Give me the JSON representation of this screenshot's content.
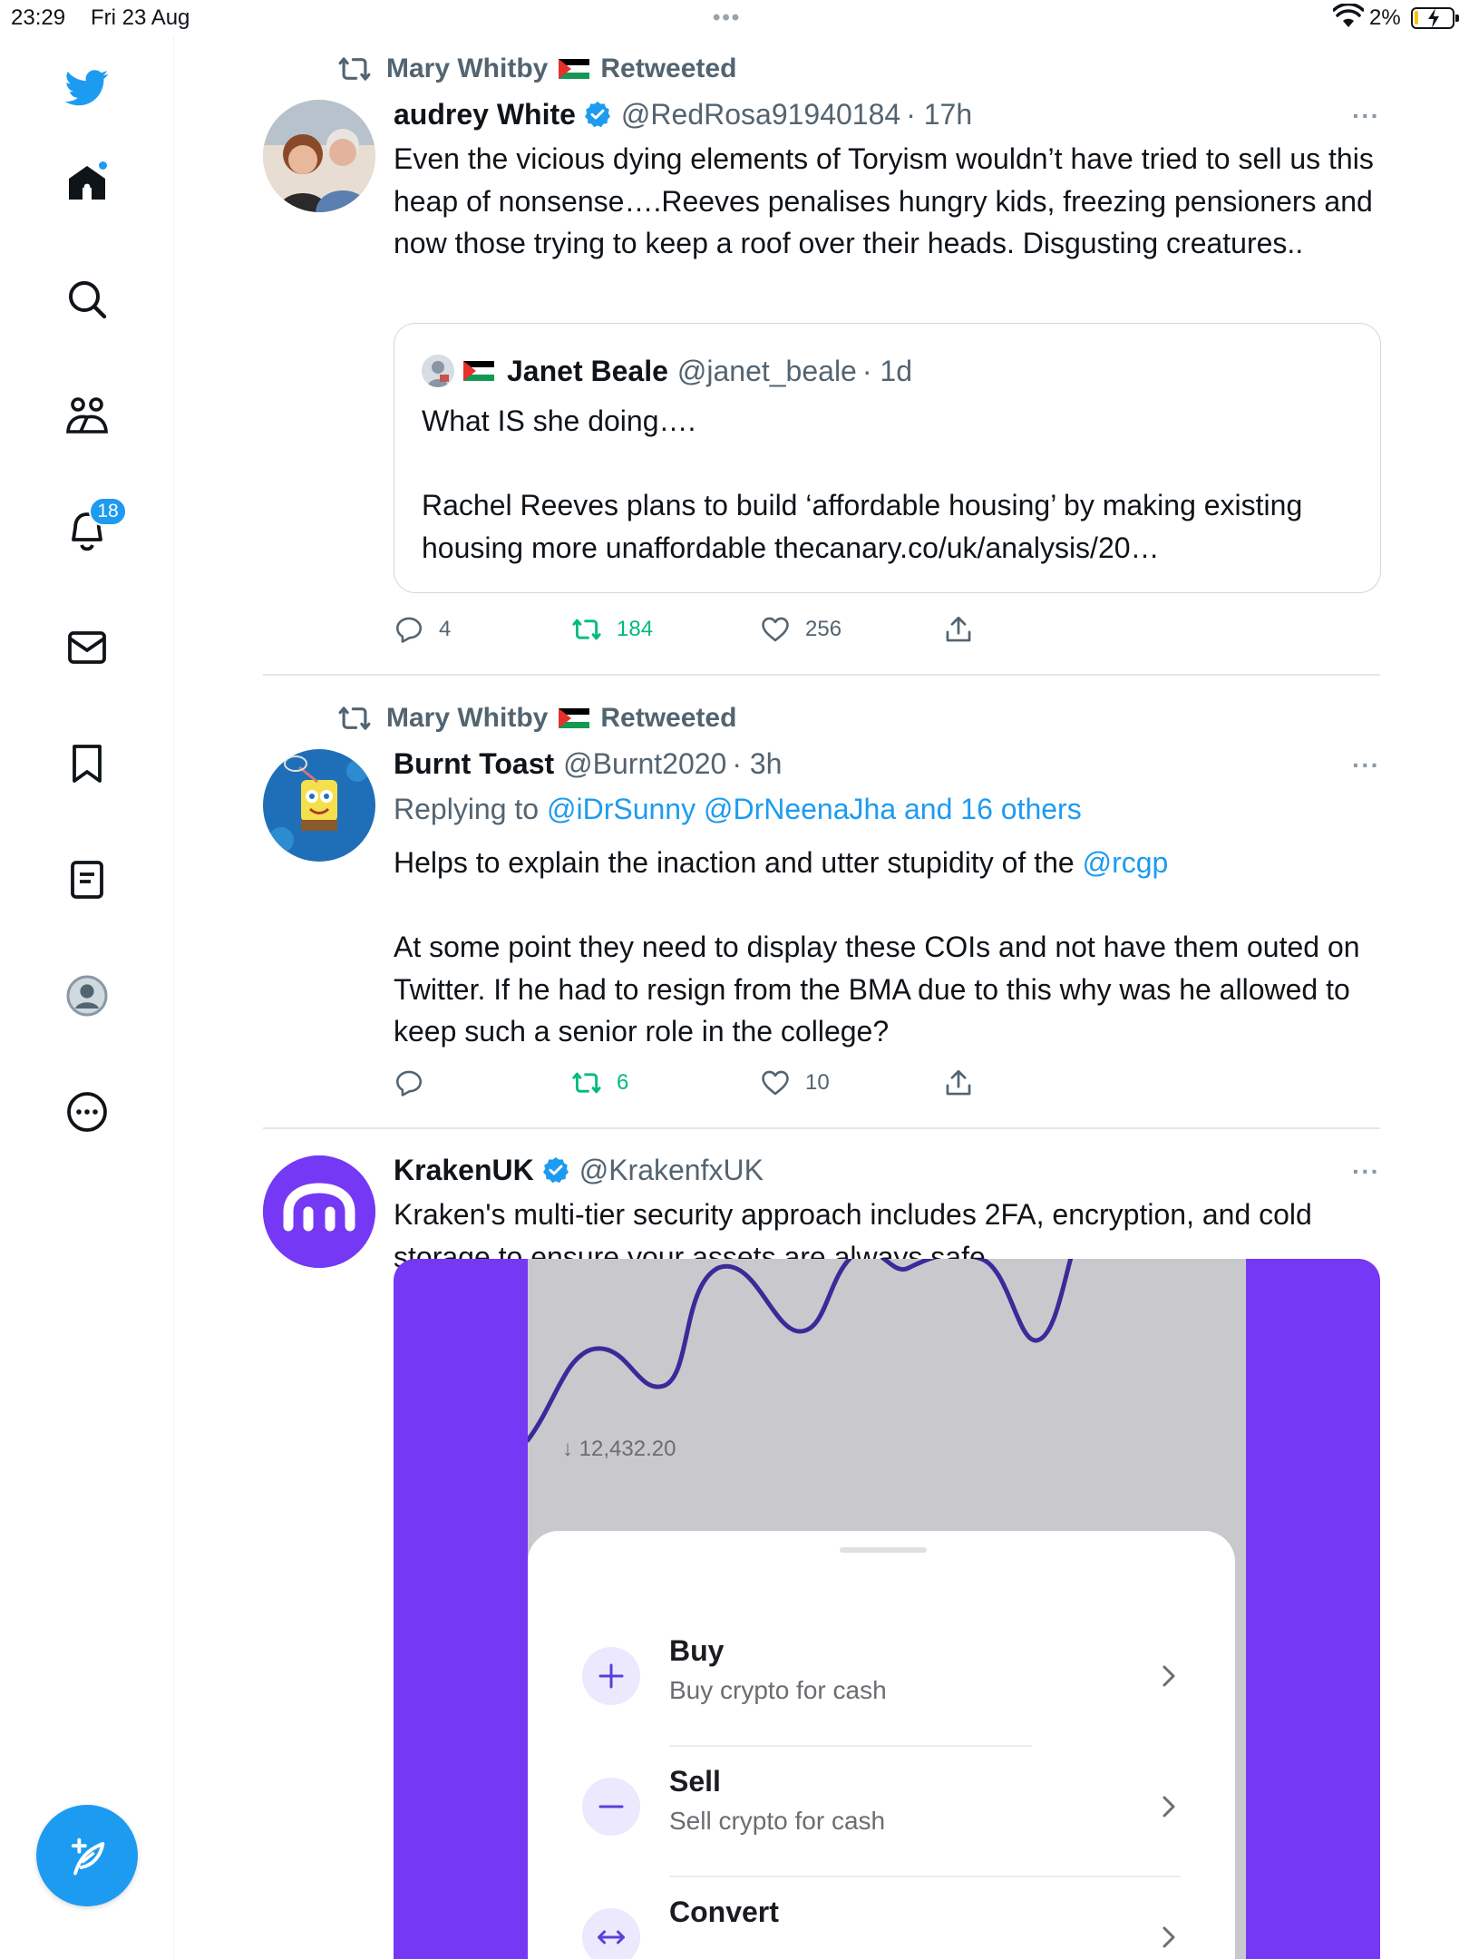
{
  "status_bar": {
    "time": "23:29",
    "date": "Fri 23 Aug",
    "dots": "•••",
    "battery_pct": "2%"
  },
  "sidebar": {
    "notifications_badge": "18"
  },
  "tweets": [
    {
      "retweeted_by": "Mary Whitby",
      "retweeted_label": "Retweeted",
      "name": "audrey White",
      "handle": "@RedRosa91940184",
      "time": "· 17h",
      "more": "···",
      "text": "Even the vicious dying elements of Toryism wouldn’t have tried to sell us this heap of nonsense….Reeves penalises hungry kids, freezing pensioners and now those trying to keep a roof over their heads. Disgusting creatures..",
      "quote": {
        "name": "Janet Beale",
        "handle": "@janet_beale",
        "time": "· 1d",
        "text_line1": "What IS she doing….",
        "text_line2": "Rachel Reeves plans to build ‘affordable housing’ by making existing housing more unaffordable thecanary.co/uk/analysis/20…"
      },
      "replies": "4",
      "retweets": "184",
      "likes": "256"
    },
    {
      "retweeted_by": "Mary Whitby",
      "retweeted_label": "Retweeted",
      "name": "Burnt Toast",
      "handle": "@Burnt2020",
      "time": "· 3h",
      "more": "···",
      "replying_prefix": "Replying to",
      "replying_to": "@iDrSunny @DrNeenaJha and 16 others",
      "text_part1": "Helps to explain the inaction and utter stupidity of the",
      "text_mention": "@rcgp",
      "text_part2": "At some point they need to display these COIs and not have them outed on Twitter. If he had to resign from the BMA due to this why was he allowed to keep such a senior role in the college?",
      "replies": "",
      "retweets": "6",
      "likes": "10"
    },
    {
      "name": "KrakenUK",
      "handle": "@KrakenfxUK",
      "more": "···",
      "text": "Kraken's multi-tier security approach includes 2FA, encryption, and cold storage to ensure your assets are always safe.",
      "media": {
        "low_value": "12,432.20",
        "items": [
          {
            "title": "Buy",
            "subtitle": "Buy crypto for cash"
          },
          {
            "title": "Sell",
            "subtitle": "Sell crypto for cash"
          },
          {
            "title": "Convert",
            "subtitle": ""
          }
        ]
      }
    }
  ],
  "colors": {
    "accent": "#1d9bf0",
    "retweet_green": "#00ba7c",
    "kraken_purple": "#7538f5"
  }
}
